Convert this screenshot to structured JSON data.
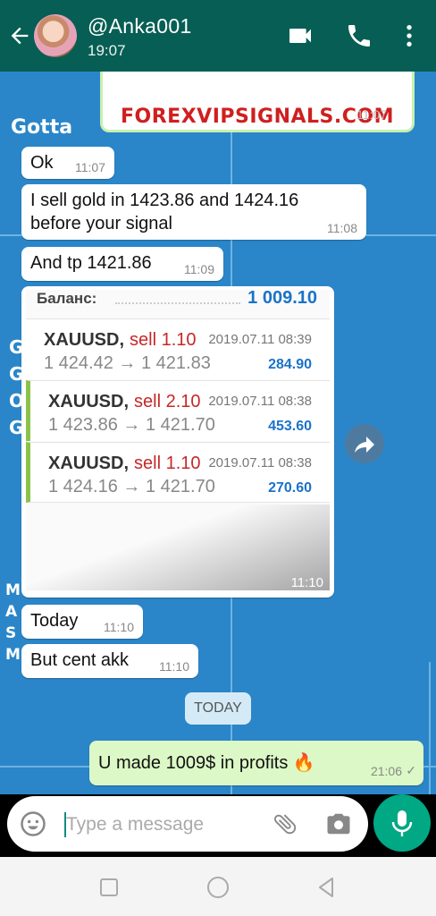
{
  "header": {
    "contact_name": "@Anka001",
    "last_seen": "19:07",
    "icons": [
      "back-arrow-icon",
      "video-call-icon",
      "phone-icon",
      "more-vert-icon"
    ],
    "bg_color": "#075e54"
  },
  "background": {
    "color": "#2a86c8",
    "texts": [
      "Gotta",
      "G",
      "G",
      "O",
      "G",
      "M",
      "A",
      "S",
      "M"
    ]
  },
  "banner": {
    "text": "FOREXVIPSIGNALS.COM",
    "time": "11:07"
  },
  "messages": [
    {
      "text": "Ok",
      "time": "11:07"
    },
    {
      "text_line1": "I sell gold in 1423.86 and 1424.16",
      "text_line2": "before your signal",
      "time": "11:08"
    },
    {
      "text": "And tp 1421.86",
      "time": "11:09"
    },
    {
      "text": "Today",
      "time": "11:10"
    },
    {
      "text": "But cent akk",
      "time": "11:10"
    }
  ],
  "screenshot": {
    "balance_label": "Баланс:",
    "balance_value": "1 009.10",
    "time": "11:10",
    "trades": [
      {
        "symbol": "XAUUSD,",
        "side": "sell 1.10",
        "datetime": "2019.07.11 08:39",
        "prices": "1 424.42 → 1 421.83",
        "profit": "284.90"
      },
      {
        "symbol": "XAUUSD,",
        "side": "sell 2.10",
        "datetime": "2019.07.11 08:38",
        "prices": "1 423.86 → 1 421.70",
        "profit": "453.60"
      },
      {
        "symbol": "XAUUSD,",
        "side": "sell 1.10",
        "datetime": "2019.07.11 08:38",
        "prices": "1 424.16 → 1 421.70",
        "profit": "270.60"
      }
    ]
  },
  "date_separator": "TODAY",
  "outgoing": {
    "text": "U made 1009$ in profits 🔥",
    "time": "21:06",
    "status": "✓"
  },
  "composer": {
    "placeholder": "Type a message",
    "icons": [
      "emoji-icon",
      "attach-icon",
      "camera-icon",
      "mic-icon"
    ]
  },
  "navbar": {
    "icons": [
      "recents-icon",
      "home-icon",
      "back-icon"
    ]
  }
}
